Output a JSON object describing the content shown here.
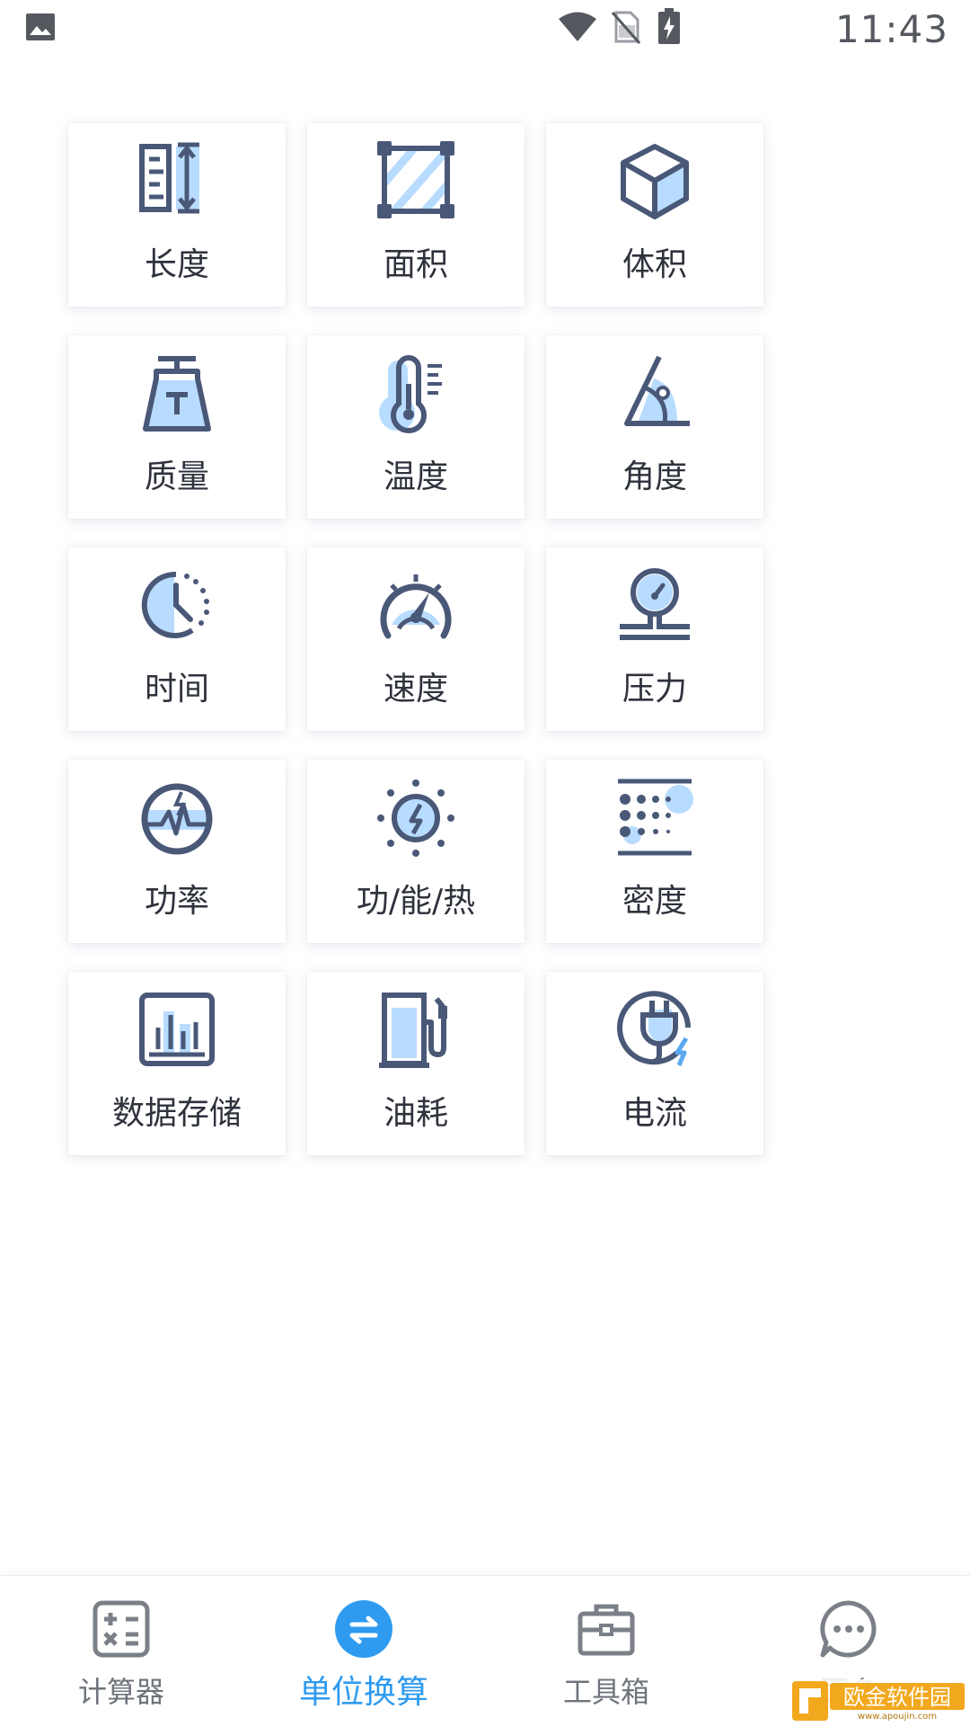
{
  "status": {
    "time": "11:43",
    "icons": [
      "image-icon",
      "wifi-icon",
      "no-sim-icon",
      "battery-charging-icon"
    ]
  },
  "accent": "#2e9bf0",
  "icon_color": "#4a5878",
  "icon_fill": "#b8dcff",
  "categories": [
    {
      "label": "长度",
      "icon": "ruler-length-icon"
    },
    {
      "label": "面积",
      "icon": "area-square-icon"
    },
    {
      "label": "体积",
      "icon": "volume-cube-icon"
    },
    {
      "label": "质量",
      "icon": "weight-mass-icon"
    },
    {
      "label": "温度",
      "icon": "thermometer-icon"
    },
    {
      "label": "角度",
      "icon": "angle-icon"
    },
    {
      "label": "时间",
      "icon": "clock-time-icon"
    },
    {
      "label": "速度",
      "icon": "speedometer-icon"
    },
    {
      "label": "压力",
      "icon": "pressure-gauge-icon"
    },
    {
      "label": "功率",
      "icon": "power-icon"
    },
    {
      "label": "功/能/热",
      "icon": "energy-sun-icon"
    },
    {
      "label": "密度",
      "icon": "density-dots-icon"
    },
    {
      "label": "数据存储",
      "icon": "data-storage-chart-icon"
    },
    {
      "label": "油耗",
      "icon": "fuel-pump-icon"
    },
    {
      "label": "电流",
      "icon": "electric-plug-icon"
    }
  ],
  "tabs": [
    {
      "label": "计算器",
      "icon": "calculator-icon",
      "active": false
    },
    {
      "label": "单位换算",
      "icon": "unit-convert-icon",
      "active": true
    },
    {
      "label": "工具箱",
      "icon": "toolbox-icon",
      "active": false
    },
    {
      "label": "更多",
      "icon": "more-icon",
      "active": false
    }
  ],
  "watermark": {
    "text": "欧金软件园",
    "subtext": "www.apoujin.com"
  }
}
